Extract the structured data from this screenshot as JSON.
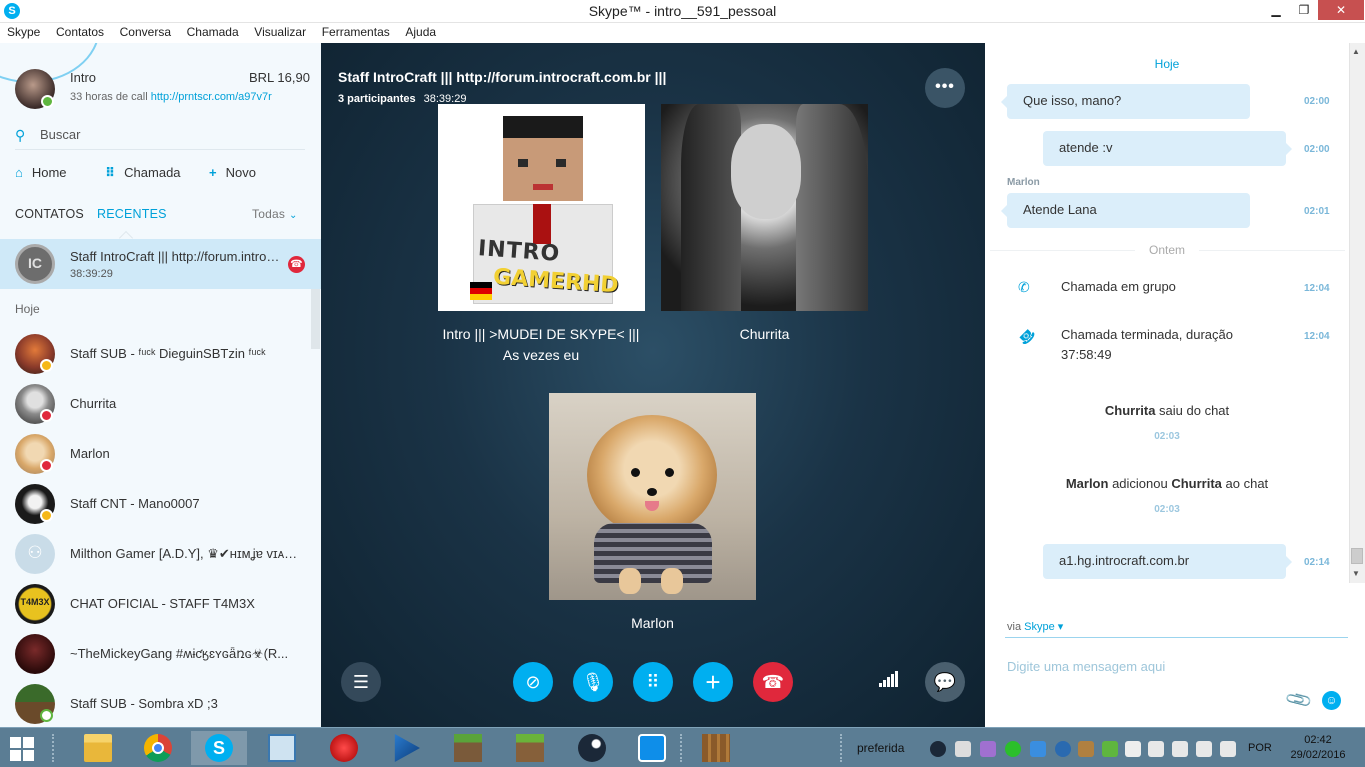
{
  "window": {
    "title": "Skype™ - intro__591_pessoal",
    "app_icon": "S",
    "min": "▁",
    "max": "❐",
    "close": "✕"
  },
  "menu": [
    "Skype",
    "Contatos",
    "Conversa",
    "Chamada",
    "Visualizar",
    "Ferramentas",
    "Ajuda"
  ],
  "profile": {
    "name": "Intro",
    "credit": "BRL 16,90",
    "subtitle": "33 horas de call",
    "link": "http://prntscr.com/a97v7r",
    "status": "online"
  },
  "search": {
    "label": "Buscar",
    "icon": "search-icon"
  },
  "nav": {
    "home": "Home",
    "call": "Chamada",
    "new": "Novo",
    "home_icon": "⌂",
    "call_icon": "⠿",
    "new_icon": "+"
  },
  "tabs": {
    "contacts": "CONTATOS",
    "recent": "RECENTES",
    "filter": "Todas",
    "filter_chev": "⌄"
  },
  "active_call": {
    "name": "Staff IntroCraft ||| http://forum.introcraft.com.br |||",
    "duration": "38:39:29",
    "hangup_icon": "☎"
  },
  "section_today": "Hoje",
  "contacts": [
    {
      "name": "Staff SUB - ᶠᵘᶜᵏ DieguinSBTzin ᶠᵘᶜᵏ",
      "status": "yellow",
      "avatar_color": "#8a3a2a"
    },
    {
      "name": "Churrita",
      "status": "red",
      "avatar_color": "#9a9a9a"
    },
    {
      "name": "Marlon",
      "status": "red",
      "avatar_color": "#d9a86a"
    },
    {
      "name": "Staff CNT - Mano0007",
      "status": "yellow",
      "avatar_color": "#1a1a1a"
    },
    {
      "name": "Milthon Gamer [A.D.Y], ♛✔ʜɪᴍʝɐ ᴠɪᴀᴛᴏʀ",
      "status": "",
      "avatar_color": "#c9dce8"
    },
    {
      "name": "CHAT OFICIAL - STAFF T4M3X",
      "status": "",
      "avatar_color": "#d8b619"
    },
    {
      "name": "~TheMickeyGang  #ʍɨƈӄɛʏɢǟռɢ☣(R...",
      "status": "",
      "avatar_color": "#3a1a1a"
    },
    {
      "name": "Staff SUB - Sombra xD ;3",
      "status": "yellow-outline",
      "avatar_color": "#4d7a3a"
    }
  ],
  "call": {
    "title": "Staff IntroCraft ||| http://forum.introcraft.com.br |||",
    "participants": "3 participantes",
    "duration": "38:39:29",
    "more_icon": "•••",
    "tiles": [
      {
        "name": "Intro ||| >MUDEI DE SKYPE< ||| As vezes eu",
        "logo_top": "INTRO",
        "logo_bottom": "GAMERHD"
      },
      {
        "name": "Churrita"
      },
      {
        "name": "Marlon"
      }
    ],
    "controls": {
      "list_icon": "☰",
      "video_icon": "⊘",
      "mic_icon": "🎙",
      "dialpad_icon": "⠿",
      "add_icon": "+",
      "hangup_icon": "☎",
      "chat_icon": "💬"
    }
  },
  "chat": {
    "today": "Hoje",
    "yesterday": "Ontem",
    "messages": [
      {
        "text": "Que isso, mano?",
        "time": "02:00"
      },
      {
        "text": "atende :v",
        "time": "02:00"
      },
      {
        "sender": "Marlon",
        "text": "Atende Lana",
        "time": "02:01"
      }
    ],
    "events": [
      {
        "icon": "✆",
        "text": "Chamada em grupo",
        "time": "12:04"
      },
      {
        "icon": "☎",
        "text": "Chamada terminada, duração",
        "text2": "37:58:49",
        "time": "12:04"
      }
    ],
    "system": [
      {
        "actor": "Churrita",
        "text": " saiu do chat",
        "time": "02:03"
      },
      {
        "actor": "Marlon",
        "mid": " adicionou ",
        "target": "Churrita",
        "text": " ao chat",
        "time": "02:03"
      }
    ],
    "last_message": {
      "text": "a1.hg.introcraft.com.br",
      "time": "02:14"
    },
    "via": "via",
    "via_service": "Skype",
    "via_chev": "▾",
    "composer_placeholder": "Digite uma mensagem aqui",
    "attach_icon": "📎",
    "emoji_icon": "☺"
  },
  "taskbar": {
    "tray_label": "preferida",
    "language": "POR",
    "time": "02:42",
    "date": "29/02/2016"
  }
}
